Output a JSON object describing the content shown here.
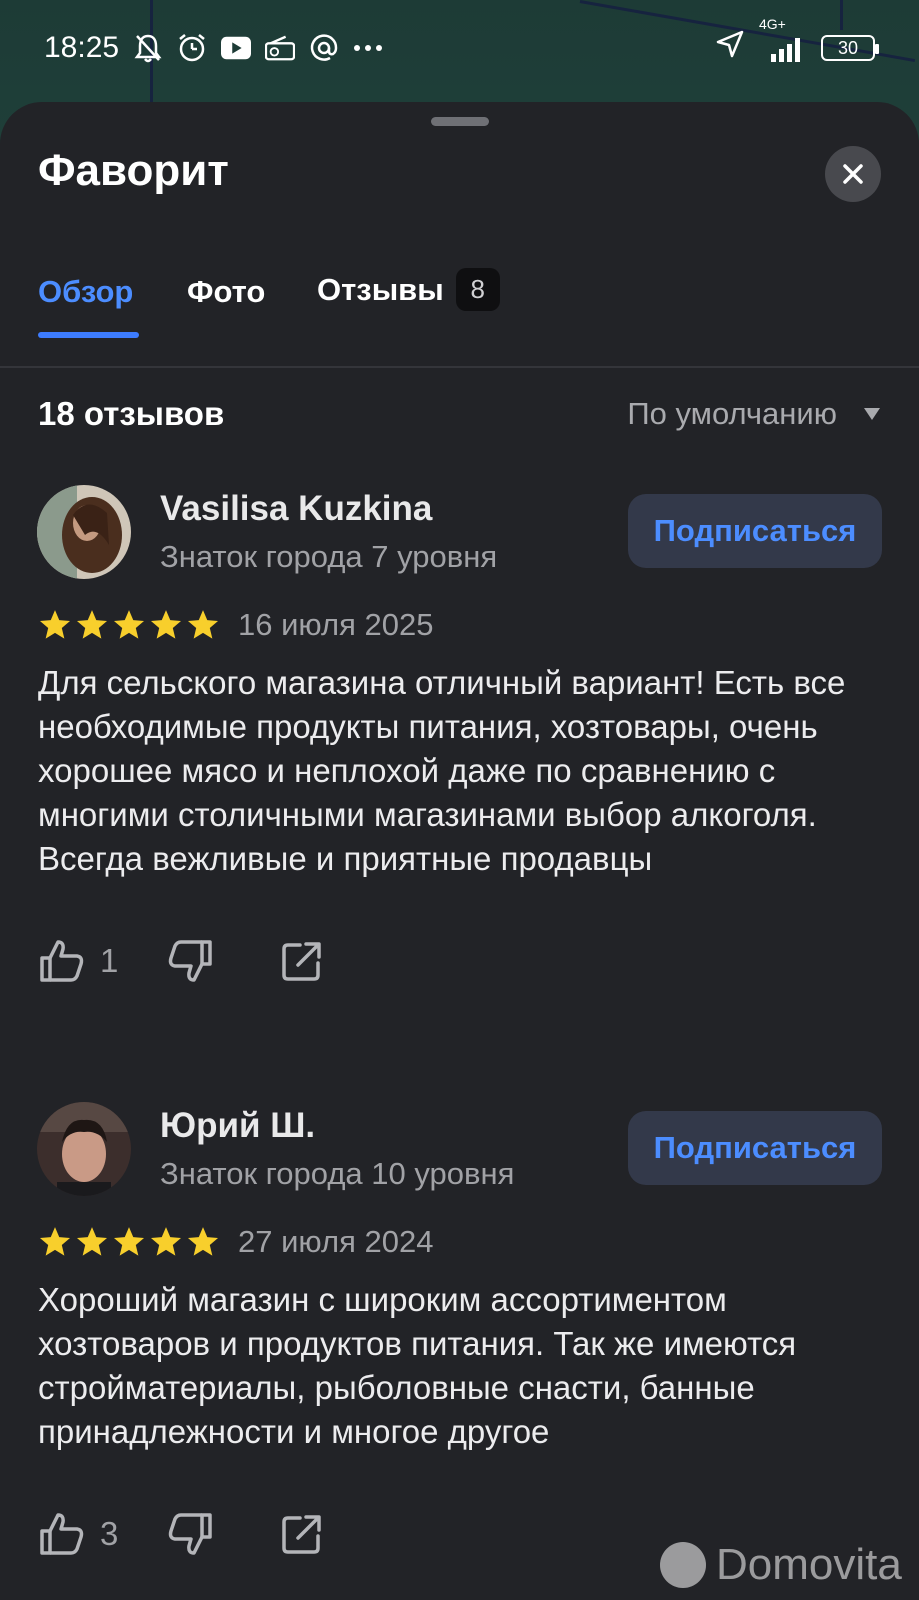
{
  "status_bar": {
    "time": "18:25",
    "network": "4G+",
    "battery": "30"
  },
  "place": {
    "title": "Фаворит"
  },
  "tabs": [
    {
      "label": "Обзор",
      "active": true
    },
    {
      "label": "Фото",
      "active": false
    },
    {
      "label": "Отзывы",
      "active": false,
      "badge": "8"
    }
  ],
  "reviews_header": {
    "count_label": "18 отзывов",
    "sort_label": "По умолчанию"
  },
  "reviews": [
    {
      "author": "Vasilisa Kuzkina",
      "level": "Знаток города 7 уровня",
      "subscribe_label": "Подписаться",
      "stars": 5,
      "date": "16 июля 2025",
      "text": "Для сельского магазина отличный вариант! Есть все необходимые продукты питания, хозтовары, очень хорошее мясо и неплохой даже по сравнению с многими столичными магазинами выбор алкоголя. Всегда вежливые и приятные продавцы",
      "likes": "1",
      "dislikes": ""
    },
    {
      "author": "Юрий Ш.",
      "level": "Знаток города 10 уровня",
      "subscribe_label": "Подписаться",
      "stars": 5,
      "date": "27 июля 2024",
      "text": "Хороший магазин с широким ассортиментом хозтоваров и  продуктов питания. Так же имеются стройматериалы, рыболовные снасти, банные принадлежности и многое другое",
      "likes": "3",
      "dislikes": ""
    }
  ],
  "watermark": "Domovita",
  "colors": {
    "accent": "#4c8dff",
    "star": "#f8cf2c",
    "sheet_bg": "#222327",
    "subscribe_bg": "#33394a"
  }
}
